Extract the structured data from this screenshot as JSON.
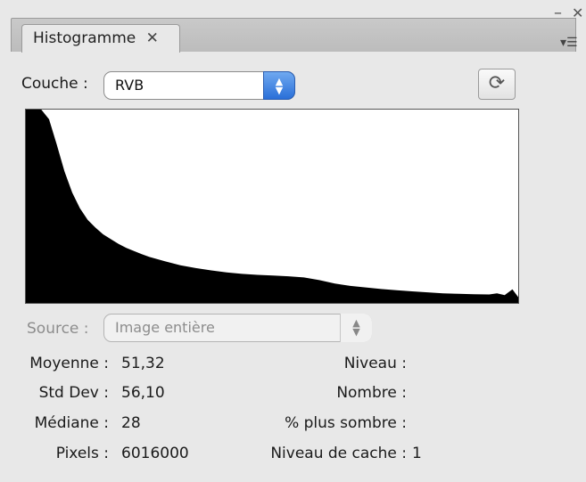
{
  "panel": {
    "tab_title": "Histogramme",
    "tab_close_glyph": "✕",
    "minimize_glyph": "–",
    "close_glyph": "✕",
    "menu_icon": "panel-menu-icon"
  },
  "channel": {
    "label": "Couche :",
    "value": "RVB",
    "refresh_icon": "refresh-icon"
  },
  "source": {
    "label": "Source :",
    "value": "Image entière"
  },
  "stats": {
    "mean_label": "Moyenne :",
    "mean_value": "51,32",
    "stddev_label": "Std Dev :",
    "stddev_value": "56,10",
    "median_label": "Médiane :",
    "median_value": "28",
    "pixels_label": "Pixels :",
    "pixels_value": "6016000",
    "level_label": "Niveau :",
    "level_value": "",
    "count_label": "Nombre :",
    "count_value": "",
    "percentile_label": "% plus sombre :",
    "percentile_value": "",
    "cache_label": "Niveau de cache :",
    "cache_value": "1"
  },
  "chart_data": {
    "type": "area",
    "x": [
      0,
      4,
      8,
      12,
      16,
      20,
      24,
      28,
      32,
      36,
      40,
      44,
      48,
      52,
      56,
      60,
      64,
      72,
      80,
      88,
      96,
      104,
      112,
      120,
      128,
      136,
      144,
      152,
      160,
      168,
      176,
      184,
      192,
      200,
      208,
      216,
      224,
      232,
      240,
      244,
      248,
      252,
      255
    ],
    "values": [
      1.0,
      1.0,
      1.0,
      0.95,
      0.82,
      0.68,
      0.57,
      0.49,
      0.43,
      0.39,
      0.355,
      0.33,
      0.305,
      0.285,
      0.268,
      0.252,
      0.238,
      0.215,
      0.195,
      0.18,
      0.168,
      0.158,
      0.15,
      0.145,
      0.142,
      0.138,
      0.132,
      0.118,
      0.1,
      0.088,
      0.08,
      0.072,
      0.066,
      0.06,
      0.055,
      0.05,
      0.047,
      0.045,
      0.044,
      0.05,
      0.04,
      0.07,
      0.03
    ],
    "xlim": [
      0,
      255
    ],
    "color": "#000000"
  }
}
